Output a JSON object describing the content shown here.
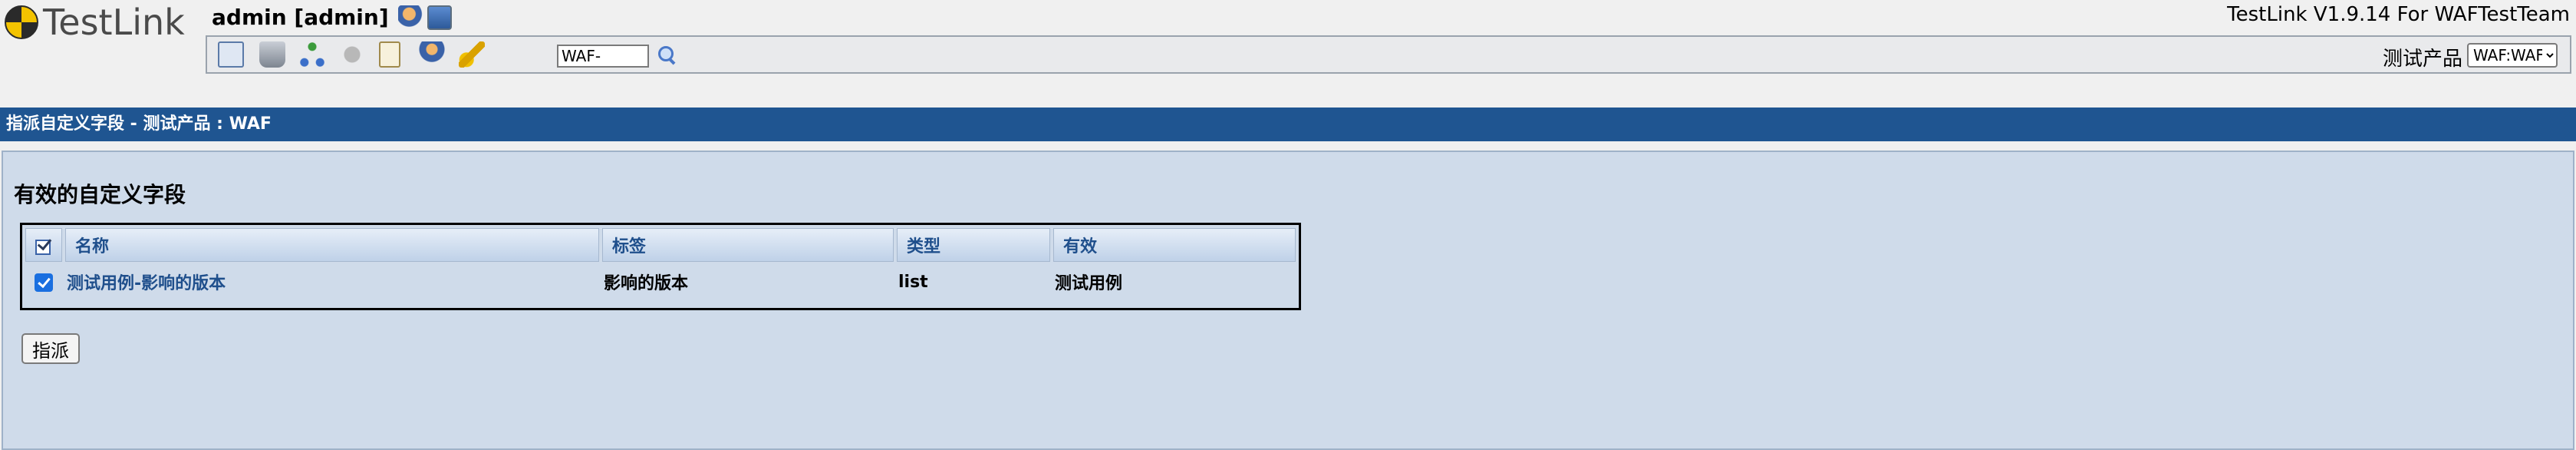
{
  "header": {
    "logo_text": "TestLink",
    "user_text": "admin [admin]",
    "version_text": "TestLink V1.9.14 For WAFTestTeam"
  },
  "toolbar": {
    "search_value": "WAF-",
    "product_label": "测试产品",
    "product_selected": "WAF:WAF"
  },
  "titlebar": {
    "text": "指派自定义字段 - 测试产品 : WAF"
  },
  "main": {
    "section_title": "有效的自定义字段",
    "table": {
      "headers": [
        "名称",
        "标签",
        "类型",
        "有效"
      ],
      "rows": [
        {
          "name": "测试用例-影响的版本",
          "label": "影响的版本",
          "type": "list",
          "active": "测试用例",
          "checked": true
        }
      ]
    },
    "assign_button": "指派"
  }
}
